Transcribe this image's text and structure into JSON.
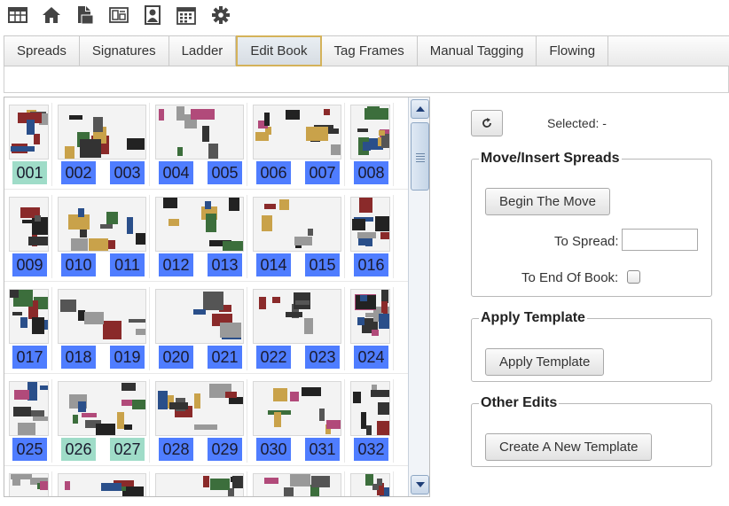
{
  "toolbar": {
    "icons": [
      "layout-icon",
      "home-icon",
      "documents-icon",
      "pages-icon",
      "portrait-icon",
      "calendar-icon",
      "gear-icon"
    ]
  },
  "tabs": [
    {
      "label": "Spreads",
      "active": false
    },
    {
      "label": "Signatures",
      "active": false
    },
    {
      "label": "Ladder",
      "active": false
    },
    {
      "label": "Edit Book",
      "active": true
    },
    {
      "label": "Tag Frames",
      "active": false
    },
    {
      "label": "Manual Tagging",
      "active": false
    },
    {
      "label": "Flowing",
      "active": false
    }
  ],
  "grid": {
    "page_labels": [
      [
        "001",
        "002",
        "003",
        "004",
        "005",
        "006",
        "007",
        "008"
      ],
      [
        "009",
        "010",
        "011",
        "012",
        "013",
        "014",
        "015",
        "016"
      ],
      [
        "017",
        "018",
        "019",
        "020",
        "021",
        "022",
        "023",
        "024"
      ],
      [
        "025",
        "026",
        "027",
        "028",
        "029",
        "030",
        "031",
        "032"
      ]
    ],
    "highlighted_pages": [
      "001",
      "026",
      "027"
    ],
    "colors": {
      "page_label_blue": "#4f7dff",
      "page_label_green": "#9fdcc8",
      "active_tab_border": "#d4b25a"
    }
  },
  "panel": {
    "selected_label": "Selected: -",
    "move_section": {
      "legend": "Move/Insert Spreads",
      "begin_button": "Begin The Move",
      "to_spread_label": "To Spread:",
      "to_spread_value": "",
      "to_end_label": "To End Of Book:",
      "to_end_checked": false
    },
    "template_section": {
      "legend": "Apply Template",
      "button": "Apply Template"
    },
    "other_section": {
      "legend": "Other Edits",
      "button": "Create A New Template"
    }
  }
}
